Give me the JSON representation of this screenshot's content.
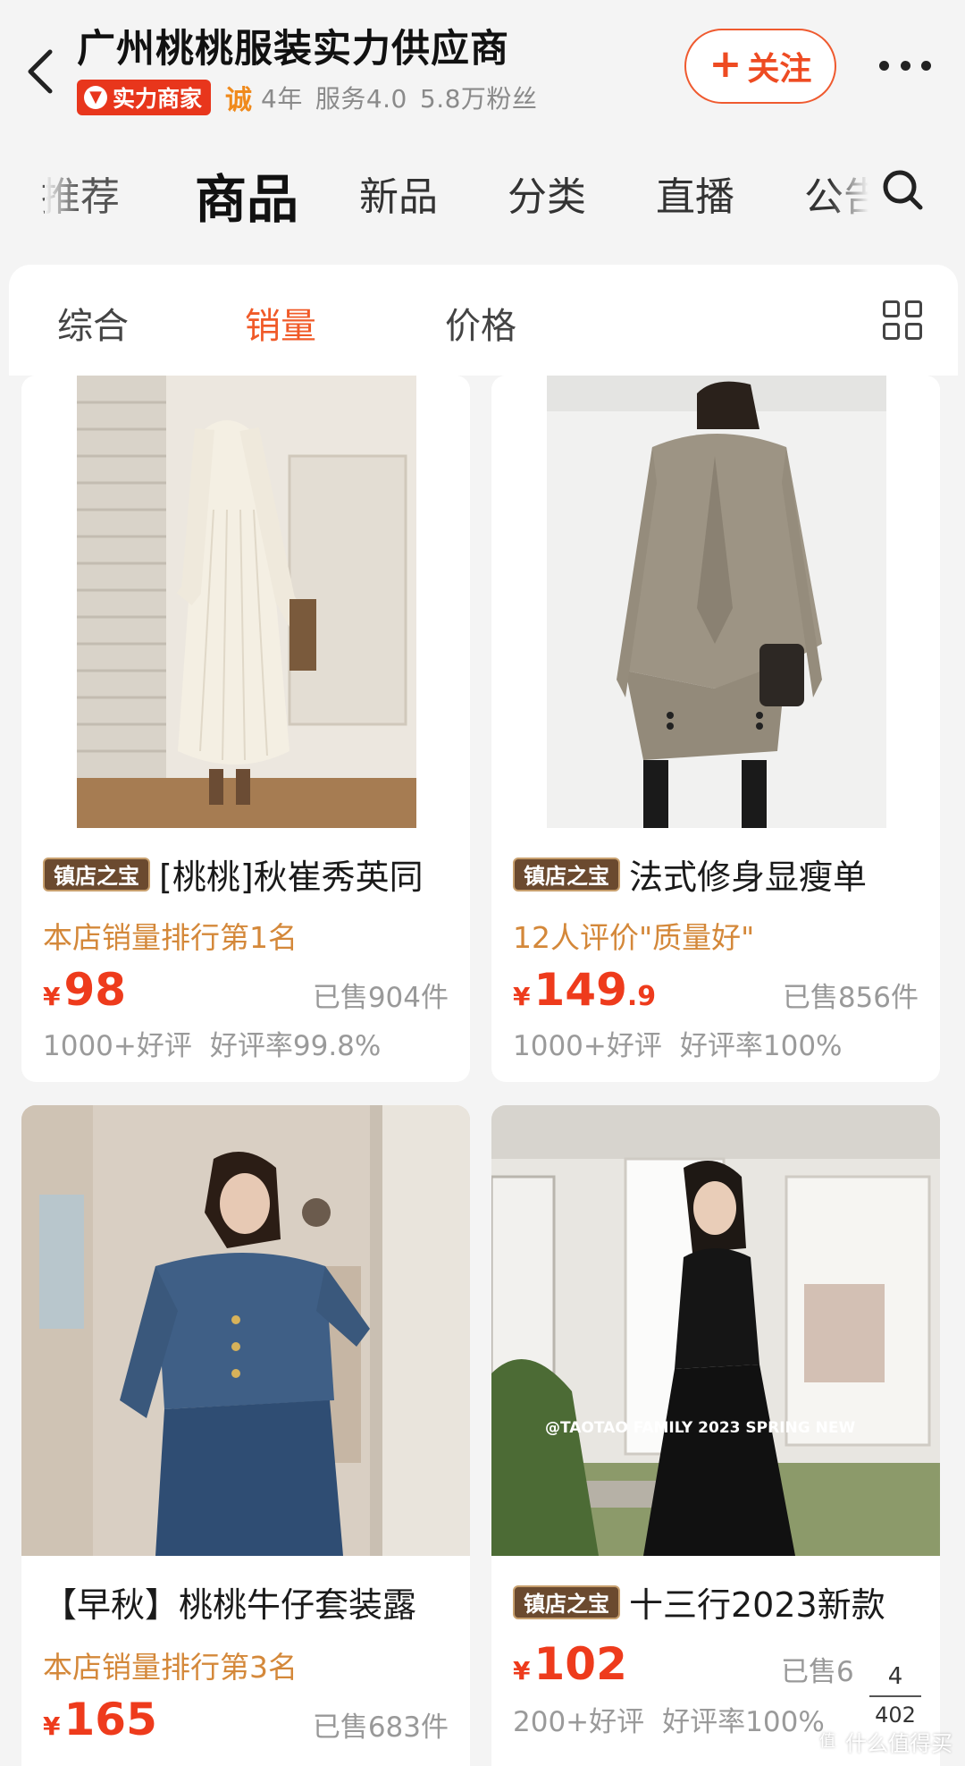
{
  "header": {
    "shop_name": "广州桃桃服装实力供应商",
    "strength_badge": "实力商家",
    "cheng_badge": "诚",
    "years": "4年",
    "service": "服务4.0",
    "fans": "5.8万粉丝",
    "follow_label": "关注"
  },
  "tabs": [
    {
      "label": "推荐"
    },
    {
      "label": "商品"
    },
    {
      "label": "新品"
    },
    {
      "label": "分类"
    },
    {
      "label": "直播"
    },
    {
      "label": "公告"
    }
  ],
  "sort": {
    "comprehensive": "综合",
    "sales": "销量",
    "price": "价格"
  },
  "products": [
    {
      "tag": "镇店之宝",
      "title": "[桃桃]秋崔秀英同",
      "subtitle": "本店销量排行第1名",
      "currency": "¥",
      "price_int": "98",
      "price_dec": "",
      "sold": "已售904件",
      "good_reviews": "1000+好评",
      "rating": "好评率99.8%"
    },
    {
      "tag": "镇店之宝",
      "title": "法式修身显瘦单",
      "subtitle": "12人评价\"质量好\"",
      "currency": "¥",
      "price_int": "149",
      "price_dec": ".9",
      "sold": "已售856件",
      "good_reviews": "1000+好评",
      "rating": "好评率100%"
    },
    {
      "tag": "",
      "title": "【早秋】桃桃牛仔套装露",
      "subtitle": "本店销量排行第3名",
      "currency": "¥",
      "price_int": "165",
      "price_dec": "",
      "sold": "已售683件",
      "good_reviews": "",
      "rating": ""
    },
    {
      "tag": "镇店之宝",
      "title": "十三行2023新款",
      "subtitle": "",
      "currency": "¥",
      "price_int": "102",
      "price_dec": "",
      "sold": "已售6",
      "good_reviews": "200+好评",
      "rating": "好评率100%",
      "image_caption": "@TAOTAO FAMILY 2023 SPRING NEW"
    }
  ],
  "page_indicator": {
    "current": "4",
    "total": "402"
  },
  "watermark": "什么值得买",
  "colors": {
    "accent": "#ee4b22",
    "price": "#ee3b1c",
    "subtitle_gold": "#d4883a",
    "strength_red": "#e8361c"
  },
  "icons": [
    "back-arrow-icon",
    "more-dots-icon",
    "search-icon",
    "grid-view-icon",
    "plus-icon"
  ]
}
